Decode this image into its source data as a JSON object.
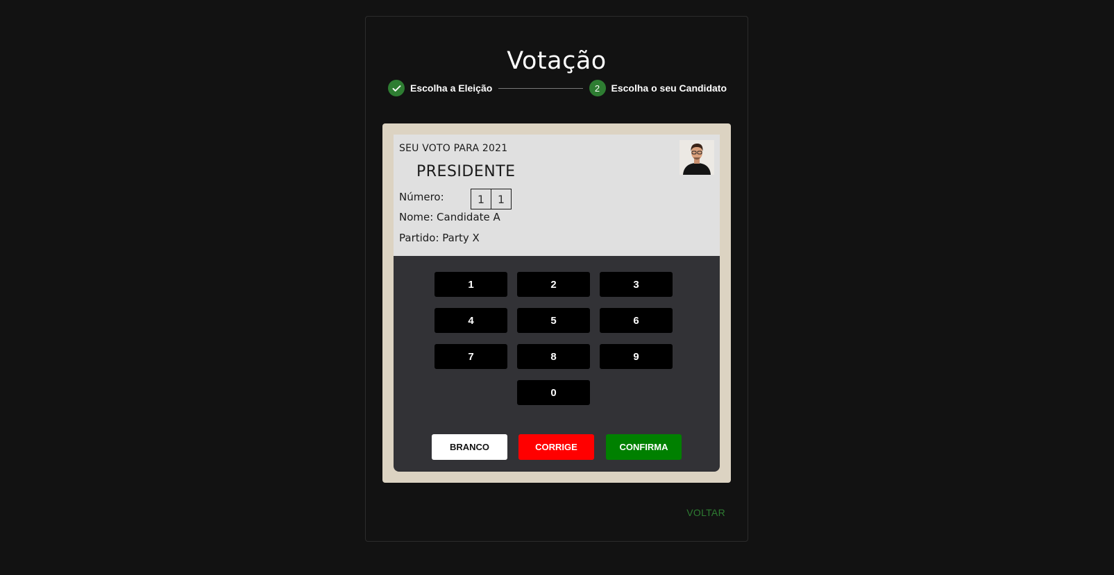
{
  "page": {
    "title": "Votação"
  },
  "stepper": {
    "steps": [
      {
        "label": "Escolha a Eleição",
        "status": "completed",
        "icon": "check-icon"
      },
      {
        "label": "Escolha o seu Candidato",
        "status": "active",
        "number": "2"
      }
    ]
  },
  "screen": {
    "heading": "SEU VOTO PARA 2021",
    "cargo": "PRESIDENTE",
    "numero_label": "Número:",
    "digits": [
      "1",
      "1"
    ],
    "nome": "Nome: Candidate A",
    "partido": "Partido: Party X"
  },
  "keypad": {
    "keys": [
      "1",
      "2",
      "3",
      "4",
      "5",
      "6",
      "7",
      "8",
      "9",
      "0"
    ]
  },
  "actions": {
    "branco": "BRANCO",
    "corrige": "CORRIGE",
    "confirma": "CONFIRMA"
  },
  "footer": {
    "voltar": "VOLTAR"
  },
  "colors": {
    "background": "#121212",
    "accent_green": "#2e7d32",
    "urna_frame": "#dcd3c2",
    "screen_bg": "#e0e0e0",
    "keypad_bg": "#323236",
    "corrige": "#ff0000",
    "confirma": "#008000"
  }
}
